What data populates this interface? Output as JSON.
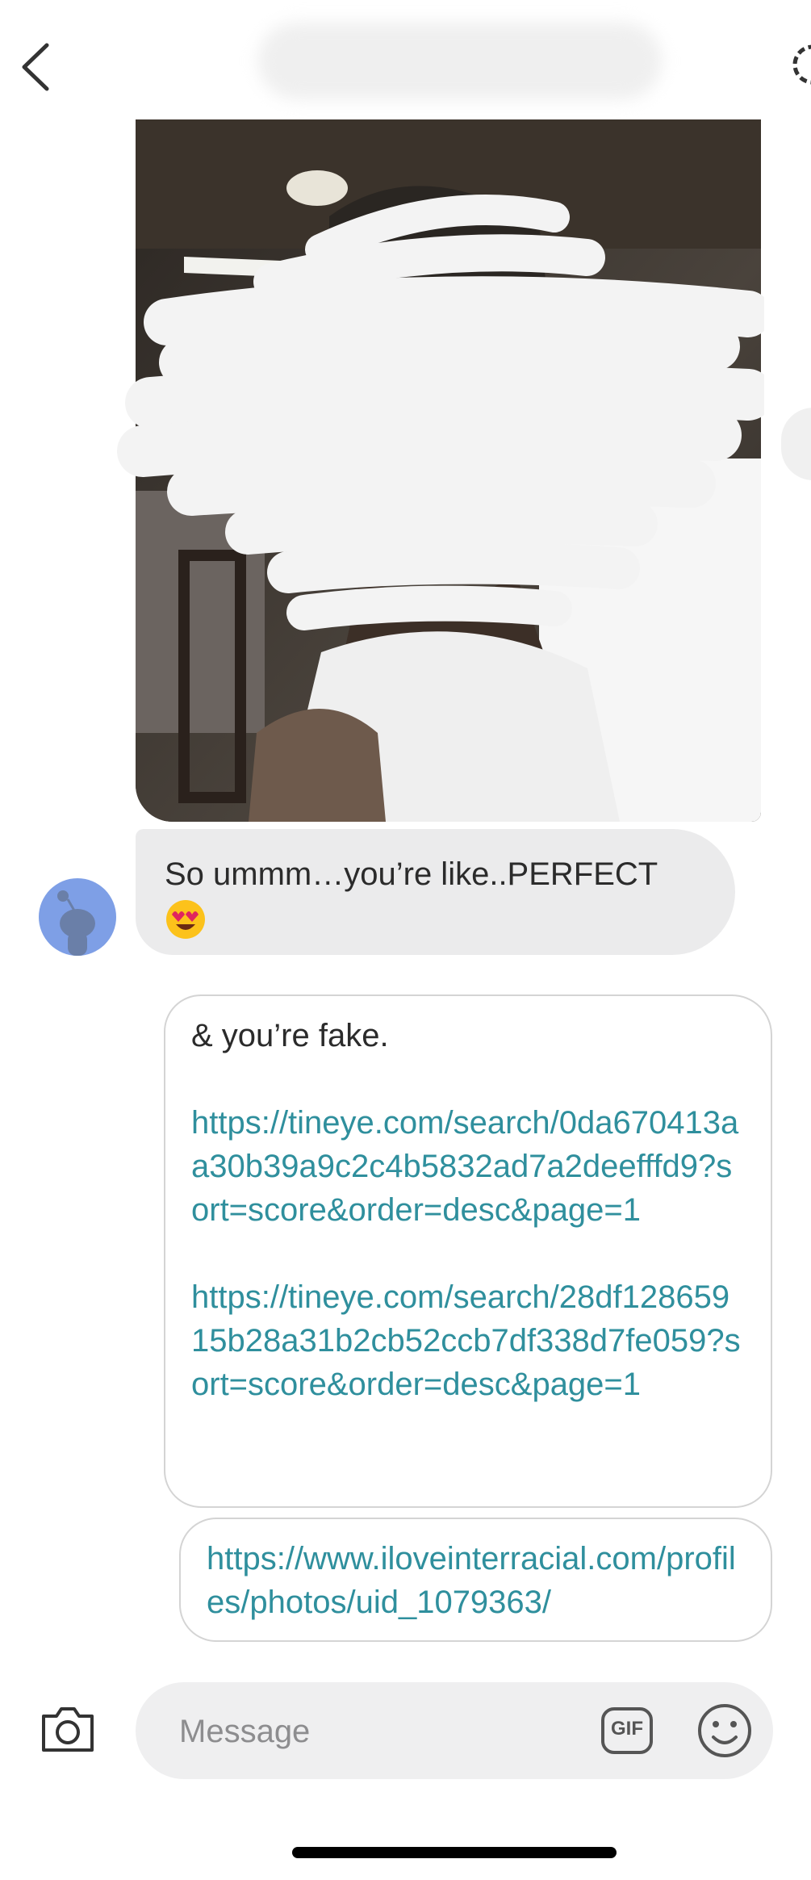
{
  "received": {
    "message_text": "So ummm…you’re like..PERFECT",
    "emoji": "heart-eyes-emoji"
  },
  "sent": {
    "message_1": {
      "intro": "& you’re fake.",
      "links": [
        "https://tineye.com/search/0da670413aa30b39a9c2c4b5832ad7a2deefffd9?sort=score&order=desc&page=1",
        "https://tineye.com/search/28df12865915b28a31b2cb52ccb7df338d7fe059?sort=score&order=desc&page=1"
      ]
    },
    "message_2": {
      "link": "https://www.iloveinterracial.com/profiles/photos/uid_1079363/"
    }
  },
  "composer": {
    "placeholder": "Message",
    "gif_label": "GIF"
  },
  "colors": {
    "link": "#2f8f9d",
    "received_bubble": "#ebebec",
    "avatar": "#7e9fe6"
  }
}
